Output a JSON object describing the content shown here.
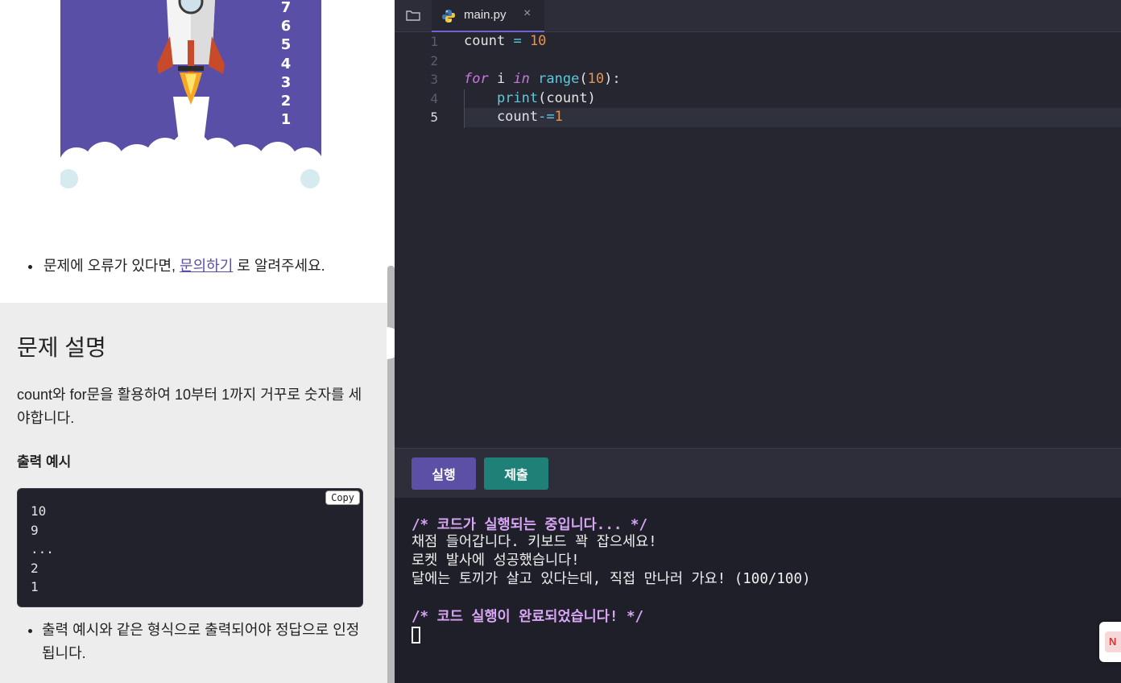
{
  "left_panel": {
    "rocket_countdown": [
      "7",
      "6",
      "5",
      "4",
      "3",
      "2",
      "1"
    ],
    "notice_text": "문제에 오류가 있다면, ",
    "notice_link": "문의하기",
    "notice_suffix": " 로 알려주세요.",
    "description_title": "문제 설명",
    "description_text": "count와 for문을 활용하여 10부터 1까지 거꾸로 숫자를 세야합니다.",
    "example_heading": "출력 예시",
    "copy_label": "Copy",
    "example_lines": [
      "10",
      "9",
      "...",
      "2",
      "1"
    ],
    "rule_text": "출력 예시와 같은 형식으로 출력되어야 정답으로 인정됩니다."
  },
  "editor": {
    "file_name": "main.py",
    "close_glyph": "×",
    "active_line": 5,
    "line_numbers": [
      "1",
      "2",
      "3",
      "4",
      "5"
    ],
    "code_lines": [
      "count = 10",
      "",
      "for i in range(10):",
      "    print(count)",
      "    count-=1"
    ]
  },
  "actions": {
    "run_label": "실행",
    "submit_label": "제출"
  },
  "terminal": {
    "start_comment": "/* 코드가 실행되는 중입니다... */",
    "output_lines": [
      "채점 들어갑니다. 키보드 꽉 잡으세요!",
      "로켓 발사에 성공했습니다!",
      "달에는 토끼가 살고 있다는데, 직접 만나러 가요! (100/100)"
    ],
    "end_comment": "/* 코드 실행이 완료되었습니다! */"
  },
  "side_badge": "N",
  "colors": {
    "run_button": "#5b4fa6",
    "submit_button": "#1f8078",
    "terminal_comment": "#d8a6f4",
    "rocket_bg": "#5a4fa6"
  },
  "icons": {
    "folder": "folder-icon",
    "python": "python-file-icon",
    "close": "close-icon"
  }
}
